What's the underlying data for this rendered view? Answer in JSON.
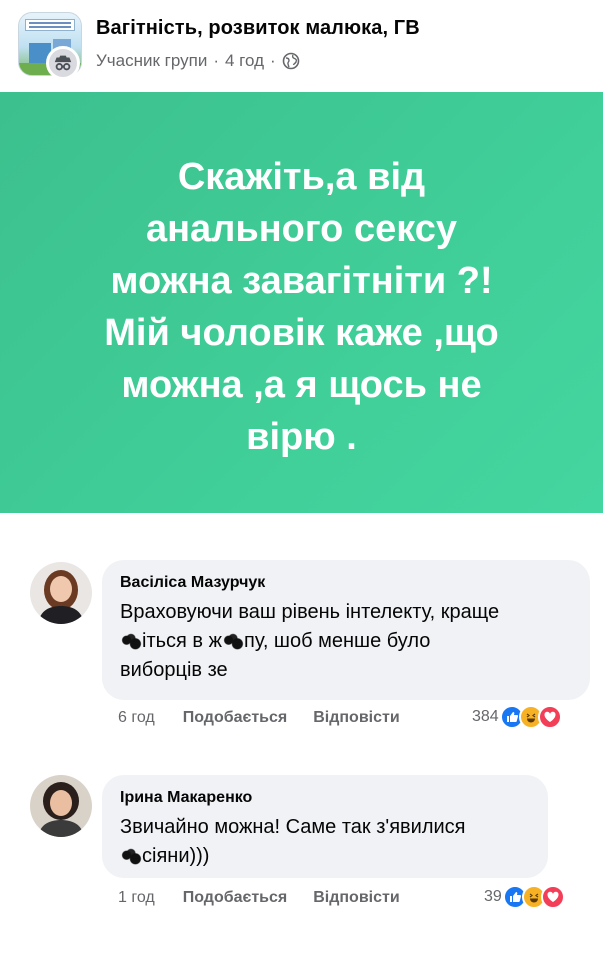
{
  "post": {
    "group_name": "Вагітність, розвиток малюка, ГВ",
    "role": "Учасник групи",
    "time": "4 год",
    "separator": "·",
    "privacy_icon": "globe-icon",
    "text": "Скажіть,а від\nанального сексу\nможна завагітніти ?!\nМій чоловік каже ,що\nможна ,а я щось не\nвірю .",
    "background_colors": [
      "#3cc08e",
      "#44d6a0"
    ]
  },
  "comments": [
    {
      "author": "Васіліса Мазурчук",
      "text_parts": [
        "Враховуючи ваш рівень інтелекту, краще\n",
        "",
        "іться в ж",
        "",
        "пу, шоб менше було\nвиборців зе"
      ],
      "time": "6 год",
      "like_label": "Подобається",
      "reply_label": "Відповісти",
      "reaction_count": "384",
      "reactions": [
        "like-icon",
        "haha-icon",
        "love-icon"
      ]
    },
    {
      "author": "Ірина Макаренко",
      "text_parts": [
        "Звичайно можна! Саме так з'явилися\n",
        "",
        "сіяни)))"
      ],
      "time": "1 год",
      "like_label": "Подобається",
      "reply_label": "Відповісти",
      "reaction_count": "39",
      "reactions": [
        "like-icon",
        "haha-icon",
        "love-icon"
      ]
    }
  ]
}
